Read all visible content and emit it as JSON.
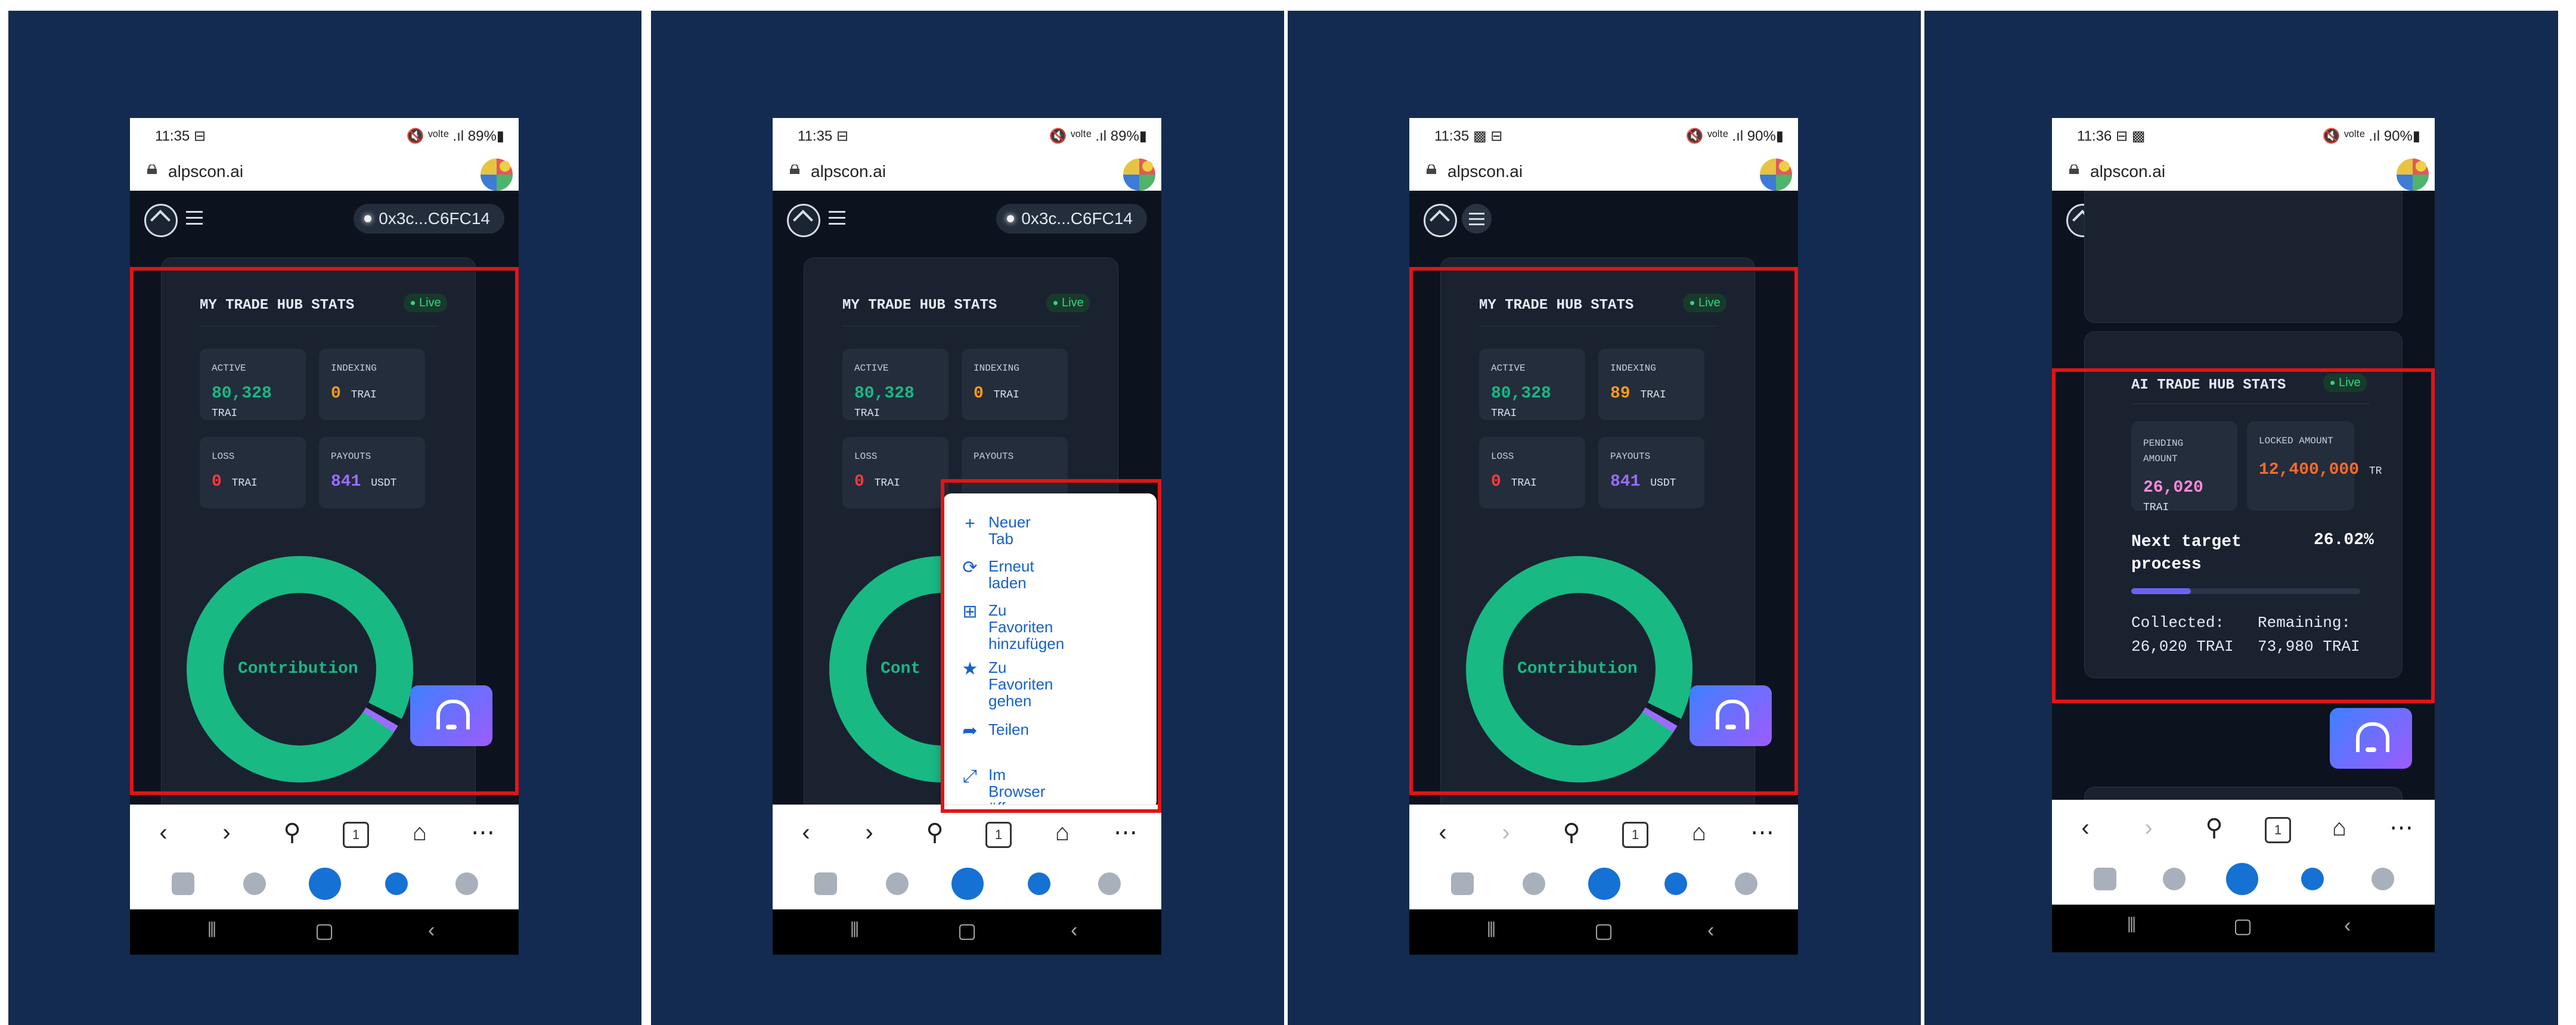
{
  "colors": {
    "frame_bg": "#132b50",
    "highlight": "#e31414",
    "green": "#19b983",
    "orange": "#ff9c1a",
    "red": "#ff3b3b",
    "purple": "#9b6cff",
    "orange_red": "#ff6a2b",
    "pink": "#ff8ad8",
    "browser_blue": "#1761c8"
  },
  "common": {
    "url": "alpscon.ai",
    "wallet": "0x3c...C6FC14",
    "live": "Live",
    "tab_count": "1",
    "toolbar": {
      "back_icon": "back-arrow-icon",
      "forward_icon": "forward-arrow-icon",
      "search_icon": "search-icon",
      "home_icon": "home-icon",
      "more_icon": "more-icon"
    },
    "dock_icons": [
      "wallet-icon",
      "clock-icon",
      "swap-icon",
      "compass-icon",
      "gear-icon"
    ],
    "android_icons": [
      "recent-apps-icon",
      "home-button-icon",
      "back-button-icon"
    ]
  },
  "screens": [
    {
      "status": {
        "time": "11:35 ⊟",
        "system": "🔇 ᵛᵒˡᵗᵉ .ıl 89%▮"
      },
      "card_title": "MY TRADE HUB STATS",
      "tiles": [
        {
          "label": "ACTIVE",
          "value": "80,328",
          "unit": "TRAI"
        },
        {
          "label": "INDEXING",
          "value": "0",
          "unit": "TRAI"
        },
        {
          "label": "LOSS",
          "value": "0",
          "unit": "TRAI"
        },
        {
          "label": "PAYOUTS",
          "value": "841",
          "unit": "USDT"
        }
      ],
      "donut_label": "Contribution"
    },
    {
      "status": {
        "time": "11:35 ⊟",
        "system": "🔇 ᵛᵒˡᵗᵉ .ıl 89%▮"
      },
      "card_title": "MY TRADE HUB STATS",
      "tiles": [
        {
          "label": "ACTIVE",
          "value": "80,328",
          "unit": "TRAI"
        },
        {
          "label": "INDEXING",
          "value": "0",
          "unit": "TRAI"
        },
        {
          "label": "LOSS",
          "value": "0",
          "unit": "TRAI"
        },
        {
          "label": "PAYOUTS",
          "value": "",
          "unit": ""
        }
      ],
      "donut_label": "Cont",
      "menu": {
        "items": [
          {
            "label": "Neuer Tab",
            "icon": "plus-icon"
          },
          {
            "label": "Erneut laden",
            "icon": "reload-icon"
          },
          {
            "label": "Zu Favoriten\nhinzufügen",
            "icon": "add-favorite-icon"
          },
          {
            "label": "Zu Favoriten\ngehen",
            "icon": "star-icon"
          },
          {
            "label": "Teilen",
            "icon": "share-icon"
          },
          {
            "label": "Im Browser öffnen",
            "icon": "open-in-browser-icon"
          }
        ]
      }
    },
    {
      "status": {
        "time": "11:35 ▩ ⊟",
        "system": "🔇 ᵛᵒˡᵗᵉ .ıl 90%▮"
      },
      "card_title": "MY TRADE HUB STATS",
      "tiles": [
        {
          "label": "ACTIVE",
          "value": "80,328",
          "unit": "TRAI"
        },
        {
          "label": "INDEXING",
          "value": "89",
          "unit": "TRAI"
        },
        {
          "label": "LOSS",
          "value": "0",
          "unit": "TRAI"
        },
        {
          "label": "PAYOUTS",
          "value": "841",
          "unit": "USDT"
        }
      ],
      "donut_label": "Contribution"
    },
    {
      "status": {
        "time": "11:36 ⊟ ▩",
        "system": "🔇 ᵛᵒˡᵗᵉ .ıl 90%▮"
      },
      "card_title": "AI TRADE HUB STATS",
      "tiles": [
        {
          "label": "PENDING\nAMOUNT",
          "value": "26,020",
          "unit": "TRAI"
        },
        {
          "label": "LOCKED AMOUNT",
          "value": "12,400,000",
          "unit": "TR"
        }
      ],
      "target_label": "Next target\nprocess",
      "target_percent": "26.02%",
      "progress": 0.2602,
      "collected": "Collected:\n26,020 TRAI",
      "remaining": "Remaining:\n73,980 TRAI"
    }
  ]
}
